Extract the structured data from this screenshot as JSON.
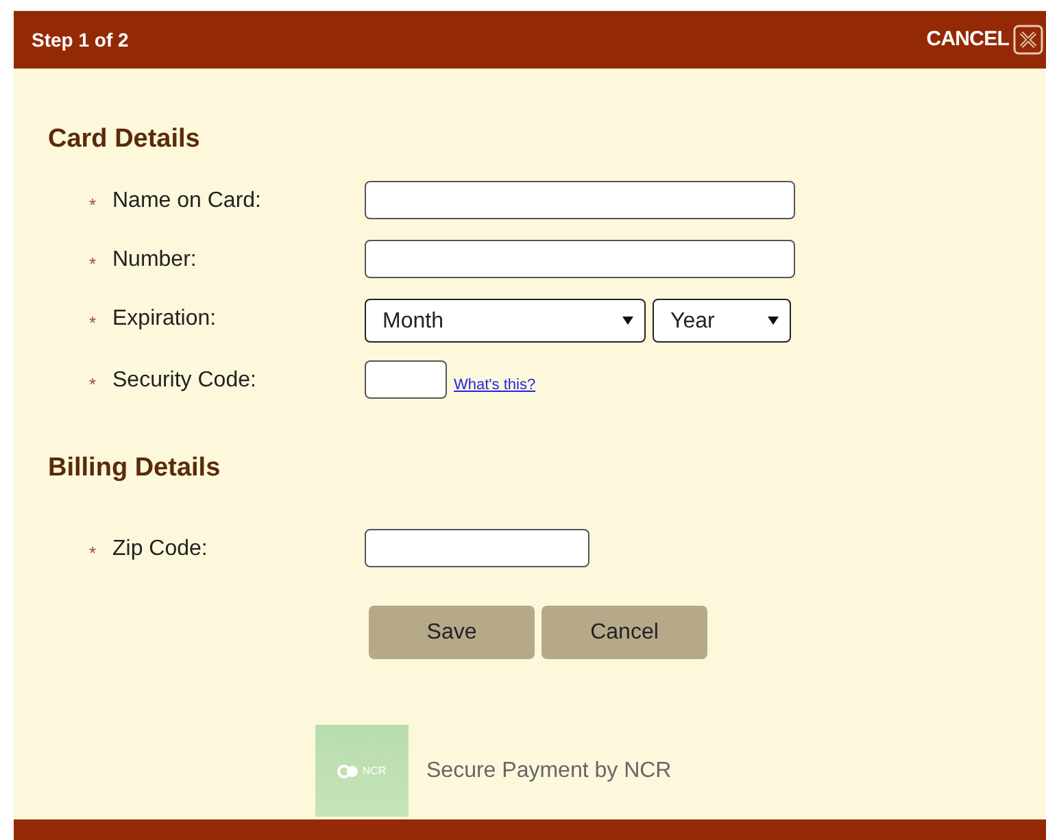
{
  "header": {
    "step": "Step 1 of 2",
    "cancel": "CANCEL"
  },
  "sections": [
    {
      "title": "Card Details",
      "fields": [
        {
          "kind": "long",
          "mark": "*",
          "label": "Name on Card:"
        },
        {
          "kind": "long",
          "mark": "*",
          "label": "Number:"
        },
        {
          "kind": "selects",
          "mark": "*",
          "label": "Expiration:",
          "selects": [
            "Month",
            "Year"
          ]
        },
        {
          "kind": "short",
          "mark": "*",
          "label": "Security Code:",
          "link": "What's this?"
        }
      ]
    },
    {
      "title": "Billing Details",
      "fields": [
        {
          "kind": "medium",
          "mark": "*",
          "label": "Zip Code:"
        }
      ]
    }
  ],
  "buttons": [
    "Save",
    "Cancel"
  ],
  "footer": {
    "logo": "NCR",
    "text": "Secure Payment by NCR"
  }
}
